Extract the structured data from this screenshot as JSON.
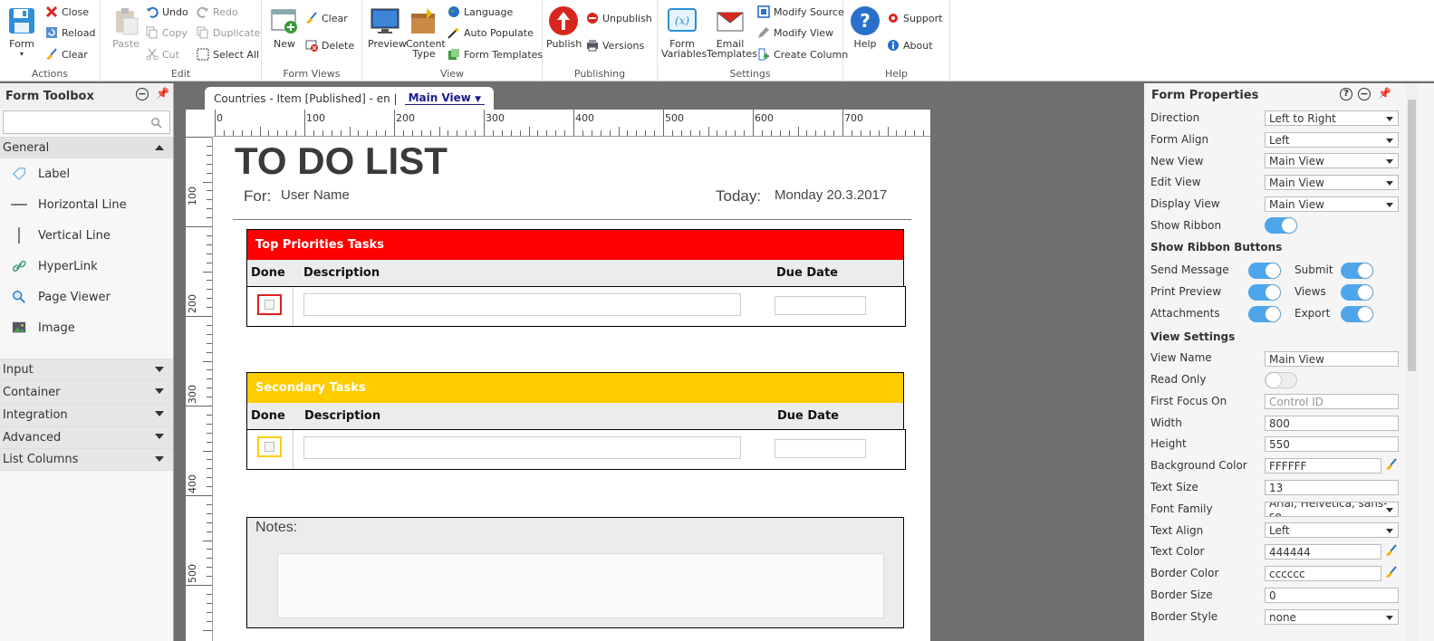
{
  "ribbon": {
    "actions": {
      "label": "Actions",
      "form": "Form",
      "close": "Close",
      "reload": "Reload",
      "clear": "Clear"
    },
    "edit": {
      "label": "Edit",
      "paste": "Paste",
      "undo": "Undo",
      "copy": "Copy",
      "cut": "Cut",
      "redo": "Redo",
      "duplicate": "Duplicate",
      "select_all": "Select All"
    },
    "form_views": {
      "label": "Form Views",
      "new": "New",
      "clear": "Clear",
      "delete": "Delete"
    },
    "view": {
      "label": "View",
      "preview": "Preview",
      "content_type": "Content Type",
      "language": "Language",
      "auto_populate": "Auto Populate",
      "form_templates": "Form Templates"
    },
    "publishing": {
      "label": "Publishing",
      "publish": "Publish",
      "unpublish": "Unpublish",
      "versions": "Versions"
    },
    "settings": {
      "label": "Settings",
      "form_variables": "Form Variables",
      "email_templates": "Email Templates",
      "modify_source": "Modify Source",
      "modify_view": "Modify View",
      "create_column": "Create Column"
    },
    "help": {
      "label": "Help",
      "help": "Help",
      "support": "Support",
      "about": "About"
    }
  },
  "toolbox": {
    "title": "Form Toolbox",
    "search_placeholder": "",
    "general": "General",
    "items": [
      "Label",
      "Horizontal Line",
      "Vertical Line",
      "HyperLink",
      "Page Viewer",
      "Image"
    ],
    "categories": [
      "Input",
      "Container",
      "Integration",
      "Advanced",
      "List Columns"
    ]
  },
  "tab": {
    "title": "Countries - Item [Published] - en |",
    "view": "Main View"
  },
  "ruler": {
    "h": [
      "0",
      "100",
      "200",
      "300",
      "400",
      "500",
      "600",
      "700"
    ],
    "v": [
      "100",
      "200",
      "300",
      "400",
      "500"
    ]
  },
  "form": {
    "title": "TO DO LIST",
    "for_label": "For:",
    "for_value": "User Name",
    "today_label": "Today:",
    "today_value": "Monday 20.3.2017",
    "top": {
      "title": "Top Priorities Tasks",
      "color": "#ff0000"
    },
    "secondary": {
      "title": "Secondary Tasks",
      "color": "#ffcc00"
    },
    "col_done": "Done",
    "col_desc": "Description",
    "col_due": "Due Date",
    "notes": "Notes:"
  },
  "props": {
    "title": "Form Properties",
    "direction": {
      "label": "Direction",
      "value": "Left to Right"
    },
    "form_align": {
      "label": "Form Align",
      "value": "Left"
    },
    "new_view": {
      "label": "New View",
      "value": "Main View"
    },
    "edit_view": {
      "label": "Edit View",
      "value": "Main View"
    },
    "display_view": {
      "label": "Display View",
      "value": "Main View"
    },
    "show_ribbon": {
      "label": "Show Ribbon",
      "on": true
    },
    "ribbon_buttons_head": "Show Ribbon Buttons",
    "send_message": "Send Message",
    "submit": "Submit",
    "print_preview": "Print Preview",
    "views": "Views",
    "attachments": "Attachments",
    "export": "Export",
    "view_settings_head": "View Settings",
    "view_name": {
      "label": "View Name",
      "value": "Main View"
    },
    "read_only": {
      "label": "Read Only",
      "on": false
    },
    "first_focus": {
      "label": "First Focus On",
      "placeholder": "Control ID"
    },
    "width": {
      "label": "Width",
      "value": "800"
    },
    "height": {
      "label": "Height",
      "value": "550"
    },
    "bg_color": {
      "label": "Background Color",
      "value": "FFFFFF"
    },
    "text_size": {
      "label": "Text Size",
      "value": "13"
    },
    "font_family": {
      "label": "Font Family",
      "value": "Arial, Helvetica, sans-se"
    },
    "text_align": {
      "label": "Text Align",
      "value": "Left"
    },
    "text_color": {
      "label": "Text Color",
      "value": "444444"
    },
    "border_color": {
      "label": "Border Color",
      "value": "cccccc"
    },
    "border_size": {
      "label": "Border Size",
      "value": "0"
    },
    "border_style": {
      "label": "Border Style",
      "value": "none"
    }
  }
}
